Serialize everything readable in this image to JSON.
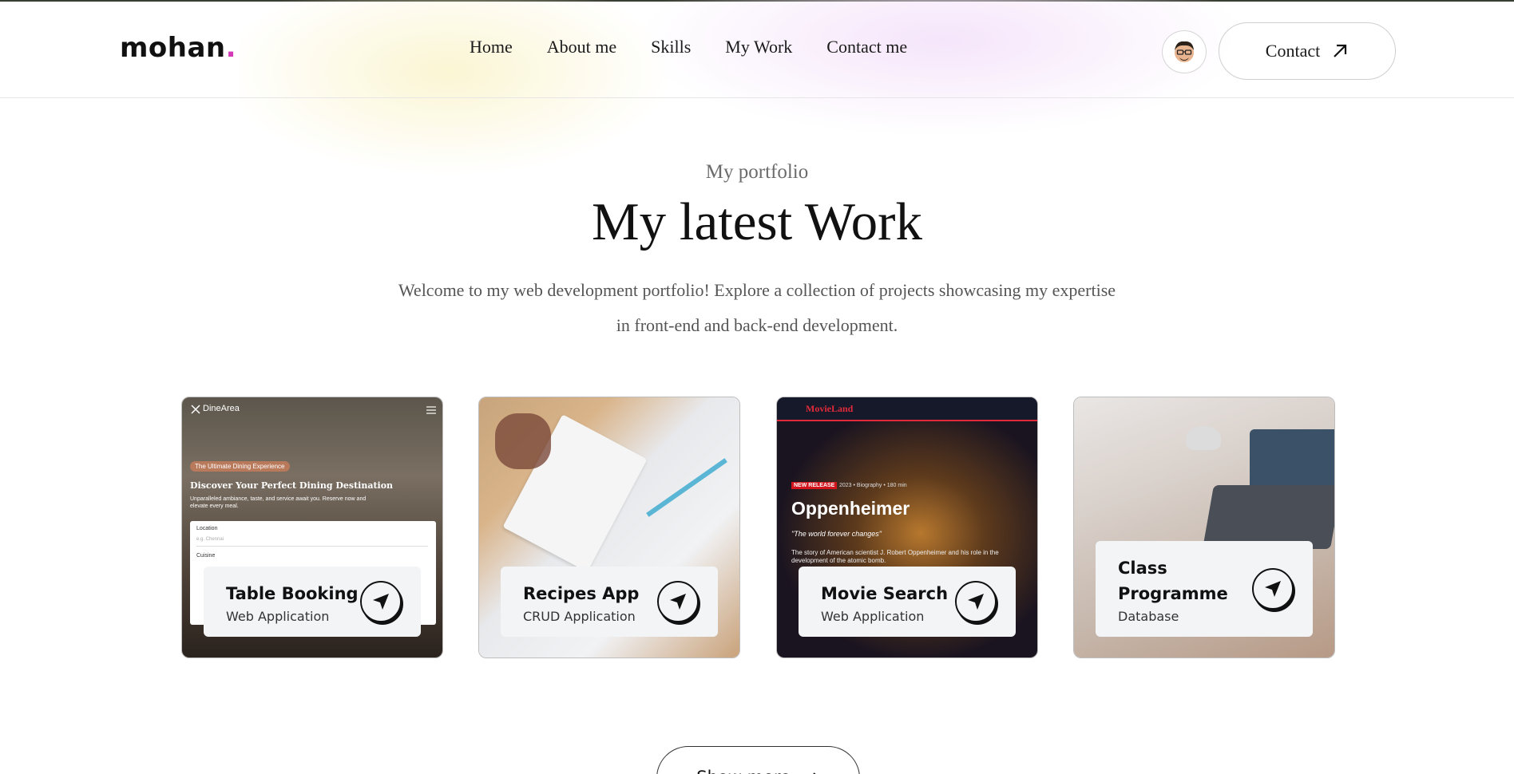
{
  "brand": {
    "name": "mohan",
    "dot": "."
  },
  "nav": {
    "items": [
      "Home",
      "About me",
      "Skills",
      "My Work",
      "Contact me"
    ]
  },
  "header": {
    "contact_label": "Contact"
  },
  "hero": {
    "subtitle": "My portfolio",
    "title": "My latest Work",
    "description": "Welcome to my web development portfolio! Explore a collection of projects showcasing my expertise in front-end and back-end development."
  },
  "projects": [
    {
      "title": "Table Booking",
      "type": "Web Application",
      "preview": {
        "brand": "DineArea",
        "badge": "The Ultimate Dining Experience",
        "heading": "Discover Your Perfect Dining Destination",
        "text": "Unparalleled ambiance, taste, and service await you. Reserve now and elevate every meal.",
        "location_label": "Location",
        "location_placeholder": "e.g. Chennai",
        "cuisine_label": "Cuisine"
      }
    },
    {
      "title": "Recipes App",
      "type": "CRUD Application"
    },
    {
      "title": "Movie Search",
      "type": "Web Application",
      "preview": {
        "brand": "MovieLand",
        "badge": "NEW RELEASE",
        "meta": "2023 • Biography • 180 min",
        "heading": "Oppenheimer",
        "tagline": "\"The world forever changes\"",
        "text": "The story of American scientist J. Robert Oppenheimer and his role in the development of the atomic bomb."
      }
    },
    {
      "title": "Class Programme",
      "type": "Database"
    }
  ],
  "show_more": {
    "label": "Show more"
  },
  "colors": {
    "accent_dot": "#d23ab8",
    "card_info_bg": "#f3f4f6",
    "movie_brand": "#e02a3a"
  },
  "icons": {
    "contact": "arrow-up-right-icon",
    "card_action": "navigation-arrow-icon",
    "show_more": "arrow-right-icon"
  }
}
